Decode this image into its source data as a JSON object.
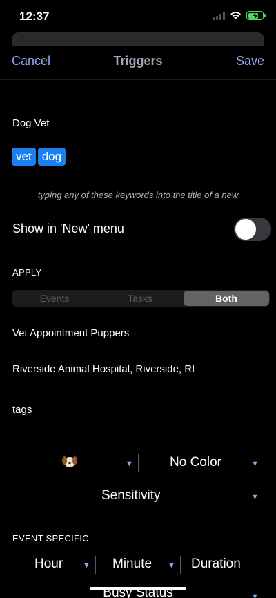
{
  "status": {
    "time": "12:37"
  },
  "nav": {
    "cancel": "Cancel",
    "title": "Triggers",
    "save": "Save"
  },
  "trigger": {
    "name": "Dog Vet",
    "keywords": [
      "vet",
      "dog"
    ],
    "hint": "typing any of these keywords into the title of a new",
    "show_in_new_label": "Show in 'New' menu",
    "show_in_new_value": false
  },
  "apply": {
    "header": "APPLY",
    "segments": [
      "Events",
      "Tasks",
      "Both"
    ],
    "selected": "Both"
  },
  "fields": {
    "title": "Vet Appointment Puppers",
    "location": "Riverside Animal Hospital, Riverside, RI",
    "tags": "tags"
  },
  "pickers": {
    "icon": "dog-face-emoji",
    "color": "No Color",
    "sensitivity": "Sensitivity"
  },
  "event_specific": {
    "header": "EVENT SPECIFIC",
    "hour": "Hour",
    "minute": "Minute",
    "duration": "Duration",
    "busy_status": "Busy Status"
  },
  "colors": {
    "accent": "#8fa8f0",
    "chip": "#1a7ff0",
    "battery": "#4cd964"
  }
}
